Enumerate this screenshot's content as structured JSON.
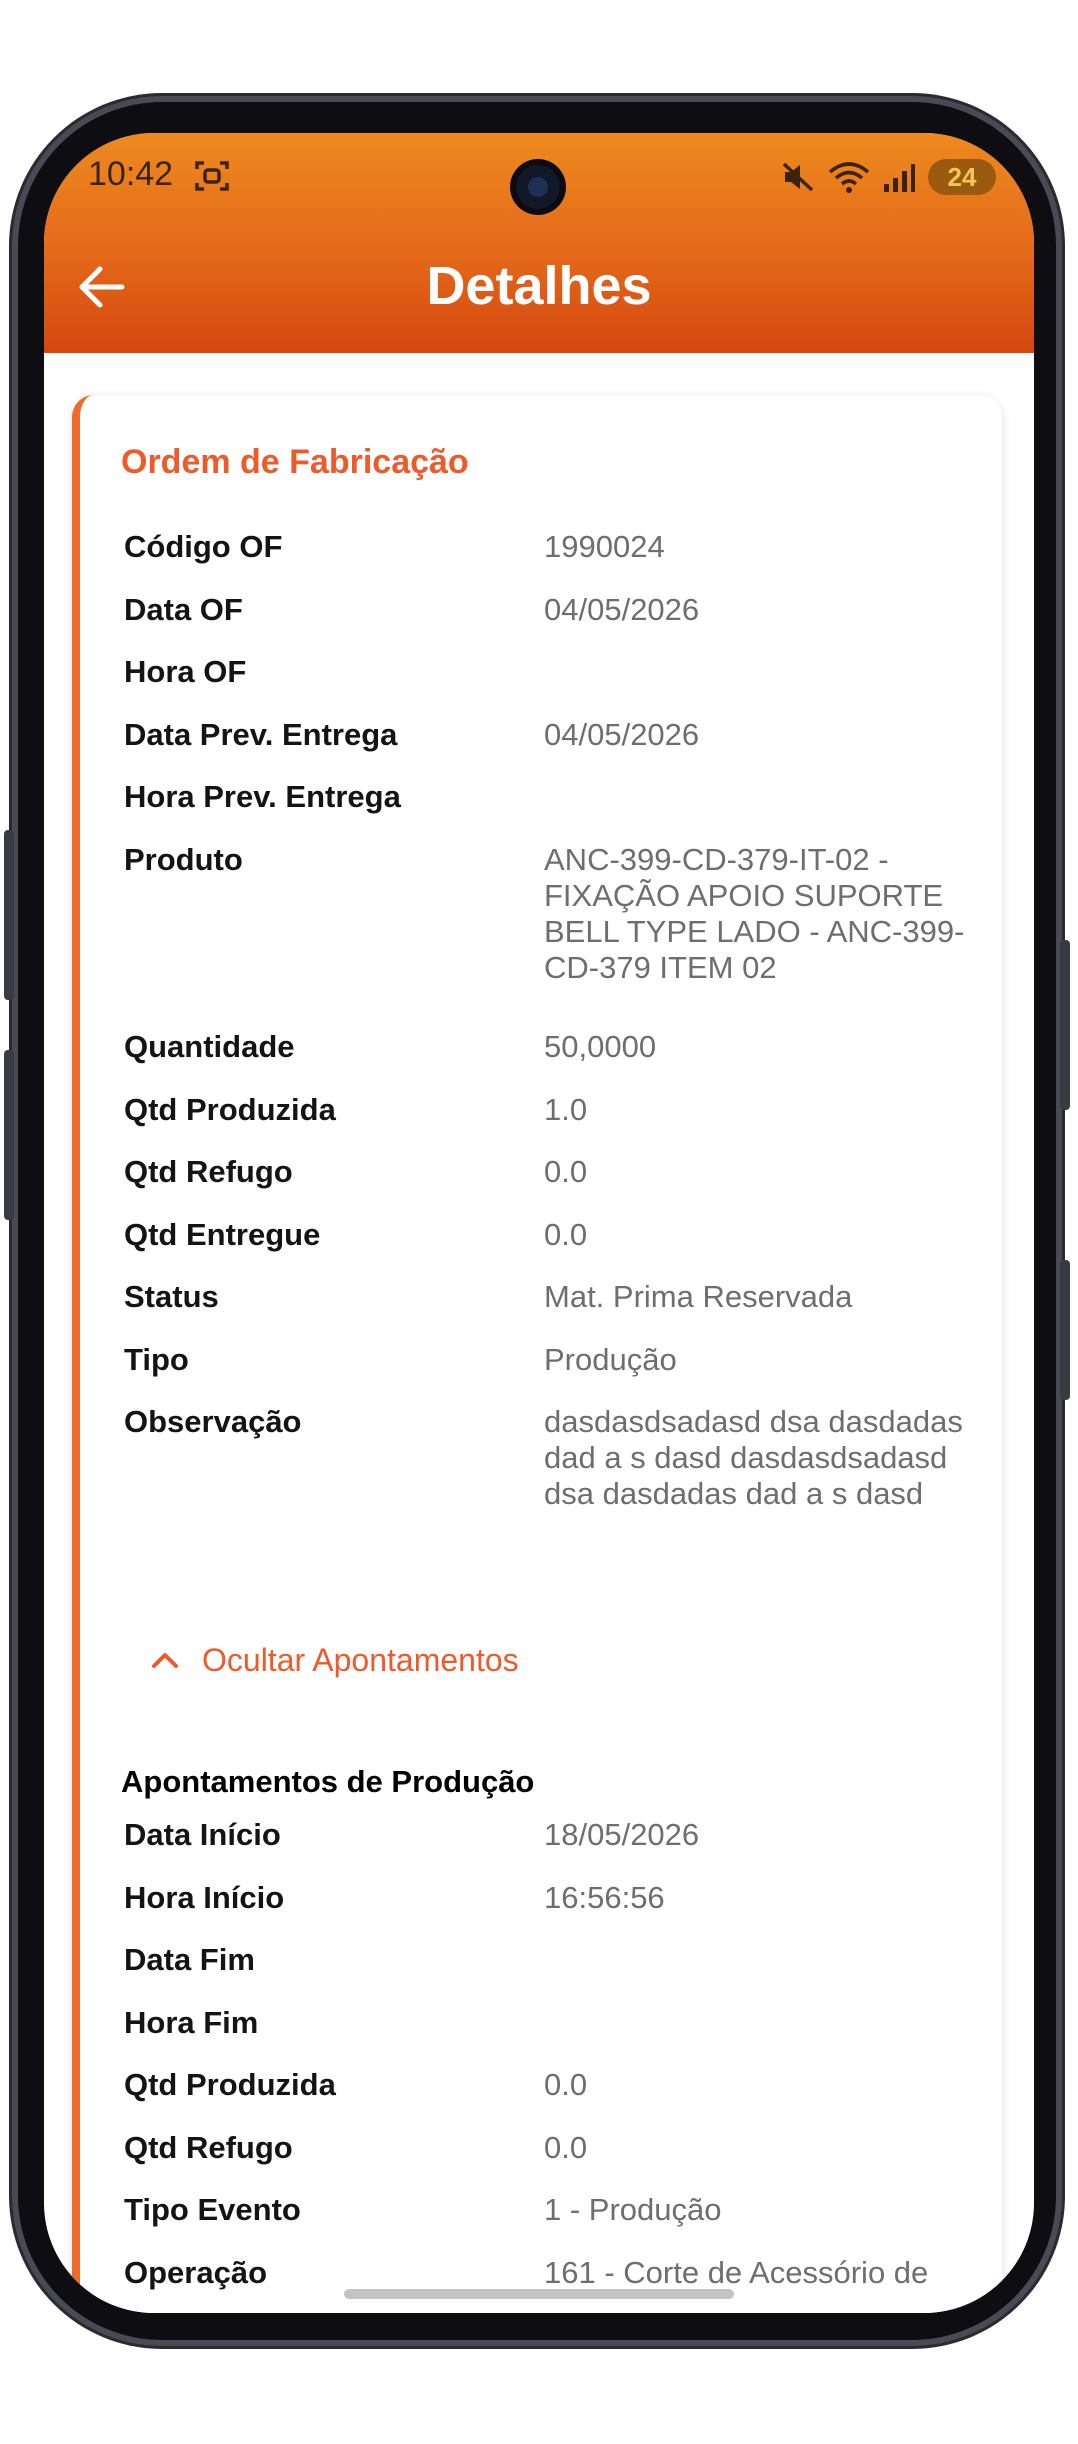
{
  "status_bar": {
    "time": "10:42",
    "battery": "24",
    "icons": [
      "screenshot-icon",
      "mute-icon",
      "wifi-icon",
      "signal-icon",
      "battery-icon"
    ]
  },
  "header": {
    "title": "Detalhes",
    "back_icon": "arrow-left-icon",
    "gradient_top": "#ee8a1f",
    "gradient_bottom": "#d4470f"
  },
  "card": {
    "title": "Ordem de Fabricação",
    "accent": "#ef5a2a",
    "fields": [
      {
        "label": "Código OF",
        "value": "1990024"
      },
      {
        "label": "Data OF",
        "value": "04/05/2026"
      },
      {
        "label": "Hora OF",
        "value": ""
      },
      {
        "label": "Data Prev. Entrega",
        "value": "04/05/2026"
      },
      {
        "label": "Hora Prev. Entrega",
        "value": ""
      },
      {
        "label": "Produto",
        "value": "ANC-399-CD-379-IT-02 - FIXAÇÃO APOIO SUPORTE BELL TYPE LADO - ANC-399-CD-379 ITEM 02"
      },
      {
        "label": "Quantidade",
        "value": "50,0000"
      },
      {
        "label": "Qtd Produzida",
        "value": "1.0"
      },
      {
        "label": "Qtd Refugo",
        "value": "0.0"
      },
      {
        "label": "Qtd Entregue",
        "value": "0.0"
      },
      {
        "label": "Status",
        "value": "Mat. Prima Reservada"
      },
      {
        "label": "Tipo",
        "value": "Produção"
      },
      {
        "label": "Observação",
        "value": "dasdasdsadasd dsa dasdadas dad a s dasd dasdasdsadasd dsa dasdadas dad a s dasd"
      }
    ],
    "toggle_label": "Ocultar Apontamentos",
    "toggle_icon": "chevron-up-icon",
    "apontamentos": {
      "title": "Apontamentos de Produção",
      "fields": [
        {
          "label": "Data Início",
          "value": "18/05/2026"
        },
        {
          "label": "Hora Início",
          "value": "16:56:56"
        },
        {
          "label": "Data Fim",
          "value": ""
        },
        {
          "label": "Hora Fim",
          "value": ""
        },
        {
          "label": "Qtd Produzida",
          "value": "0.0"
        },
        {
          "label": "Qtd Refugo",
          "value": "0.0"
        },
        {
          "label": "Tipo Evento",
          "value": "1 - Produção"
        },
        {
          "label": "Operação",
          "value": "161 - Corte de Acessório de"
        }
      ]
    }
  }
}
